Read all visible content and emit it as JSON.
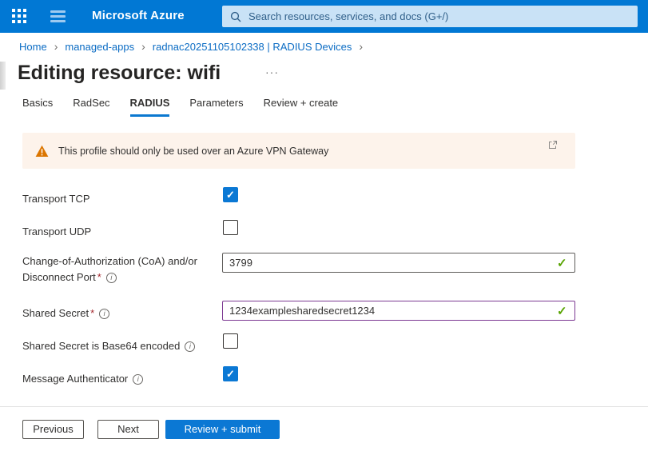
{
  "colors": {
    "topbar_blue": "#0178d4",
    "accent_blue": "#0b78d4",
    "search_bg": "#c9e2f6",
    "banner_bg": "#fdf3eb",
    "warning_orange": "#db7500",
    "valid_green": "#57a300",
    "modified_purple": "#7d3a93"
  },
  "icons": {
    "more_options": "···",
    "breadcrumb_separator": "›",
    "checkmark": "✓",
    "info_glyph": "i"
  },
  "topbar": {
    "brand": "Microsoft Azure",
    "search_placeholder": "Search resources, services, and docs (G+/)"
  },
  "breadcrumb": {
    "items": [
      "Home",
      "managed-apps",
      "radnac20251105102338 | RADIUS Devices"
    ]
  },
  "page": {
    "title": "Editing resource: wifi"
  },
  "tabs": [
    {
      "label": "Basics",
      "active": false
    },
    {
      "label": "RadSec",
      "active": false
    },
    {
      "label": "RADIUS",
      "active": true
    },
    {
      "label": "Parameters",
      "active": false
    },
    {
      "label": "Review + create",
      "active": false
    }
  ],
  "banner": {
    "text": "This profile should only be used over an Azure VPN Gateway"
  },
  "form": {
    "fields": [
      {
        "label": "Transport TCP",
        "type": "checkbox",
        "checked": true
      },
      {
        "label": "Transport UDP",
        "type": "checkbox",
        "checked": false
      },
      {
        "label": "Change-of-Authorization (CoA) and/or Disconnect Port",
        "required": "*",
        "type": "text",
        "value": "3799",
        "valid": true
      },
      {
        "label": "Shared Secret",
        "required": "*",
        "type": "text",
        "value": "1234examplesharedsecret1234",
        "valid": true,
        "modified": true
      },
      {
        "label": "Shared Secret is Base64 encoded",
        "type": "checkbox",
        "checked": false
      },
      {
        "label": "Message Authenticator",
        "type": "checkbox",
        "checked": true
      }
    ]
  },
  "footer": {
    "buttons": [
      {
        "label": "Previous",
        "variant": "outline"
      },
      {
        "label": "Next",
        "variant": "outline"
      },
      {
        "label": "Review + submit",
        "variant": "primary"
      }
    ]
  }
}
